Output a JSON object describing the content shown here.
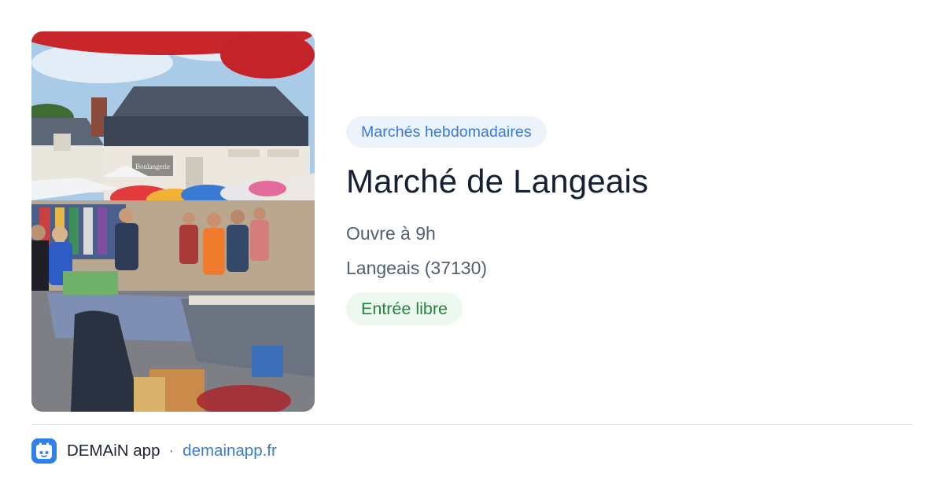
{
  "event": {
    "category": "Marchés hebdomadaires",
    "title": "Marché de Langeais",
    "hours": "Ouvre à 9h",
    "location": "Langeais (37130)",
    "price": "Entrée libre"
  },
  "image": {
    "shop_sign": "Boulangerie"
  },
  "footer": {
    "app_name": "DEMAiN app",
    "separator": "·",
    "link": "demainapp.fr"
  },
  "colors": {
    "accent_blue": "#3b7ad6",
    "category_bg": "#edf3fb",
    "price_green": "#25823f",
    "price_bg": "#edf9ef",
    "title": "#162032",
    "meta_text": "#536070",
    "divider": "#d9e2ea"
  },
  "icons": {
    "app_logo": "calendar-app-icon"
  }
}
